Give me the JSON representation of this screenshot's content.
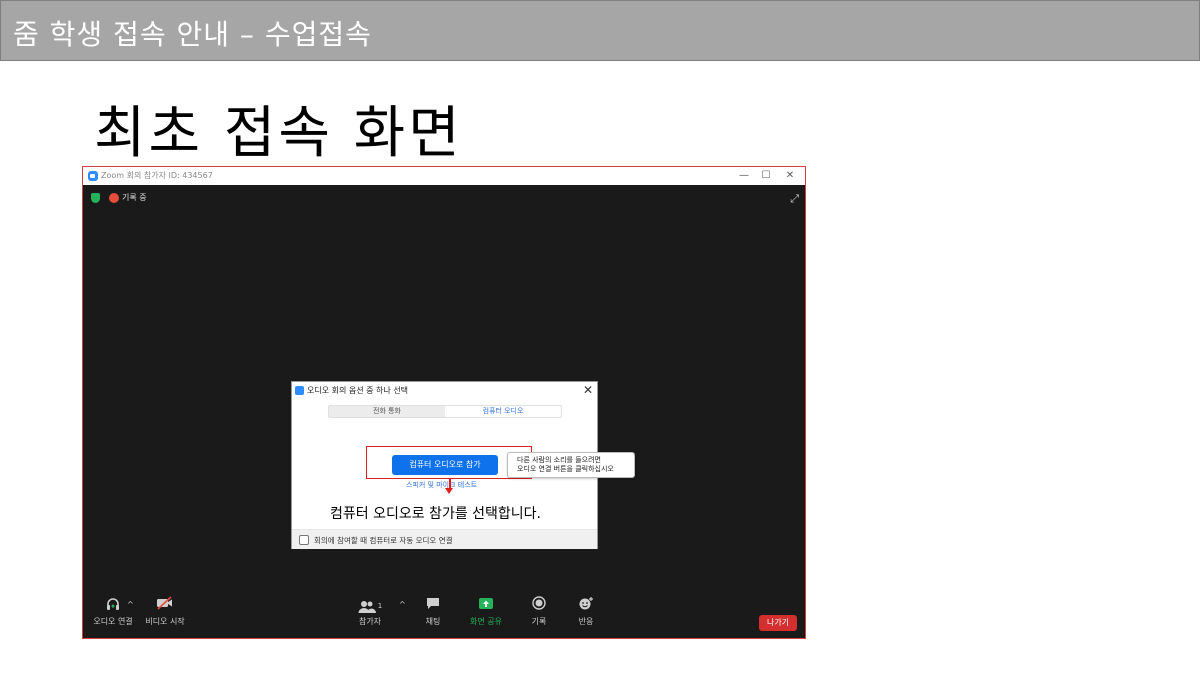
{
  "slide": {
    "header_title": "줌 학생 접속 안내 – 수업접속",
    "title": "최초 접속 화면"
  },
  "zoom_window": {
    "title": "Zoom 회의 참가자 ID: 434567",
    "controls": {
      "minimize": "—",
      "maximize": "☐",
      "close": "✕"
    },
    "status": {
      "recording_label": "기록 중"
    },
    "toolbar": {
      "audio_label": "오디오 연결",
      "video_label": "비디오 시작",
      "participants_label": "참가자",
      "participants_count": "1",
      "chat_label": "채팅",
      "share_label": "화면 공유",
      "record_label": "기록",
      "reactions_label": "반응",
      "leave_label": "나가기"
    }
  },
  "dialog": {
    "title": "오디오 회의 옵션 중 하나 선택",
    "tabs": [
      {
        "label": "전화 통화",
        "active": false
      },
      {
        "label": "컴퓨터 오디오",
        "active": true
      }
    ],
    "join_button": "컴퓨터 오디오로 참가",
    "tooltip_line1": "다른 사람의 소리를 들으려면",
    "tooltip_line2": "오디오 연결 버튼을 클릭하십시오",
    "speaker_test": "스피커 및 마이크 테스트",
    "caption": "컴퓨터 오디오로 참가를 선택합니다.",
    "auto_join_label": "회의에 참여할 때 컴퓨터로 자동 오디오 연결",
    "auto_join_checked": false
  },
  "colors": {
    "header_bg": "#a6a6a6",
    "zoom_blue": "#0e72ed",
    "highlight_red": "#e02020",
    "share_green": "#24b35a",
    "leave_red": "#d32f2f"
  },
  "icons": [
    "zoom-logo-icon",
    "shield-icon",
    "record-icon",
    "fullscreen-icon",
    "headphones-icon",
    "video-off-icon",
    "participants-icon",
    "chat-icon",
    "share-screen-icon",
    "record-button-icon",
    "reactions-icon",
    "close-icon",
    "caret-up-icon"
  ]
}
